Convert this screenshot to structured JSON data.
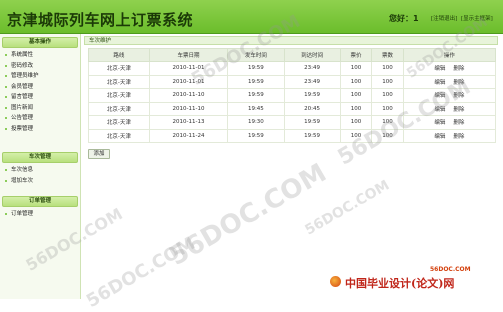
{
  "header": {
    "title": "京津城际列车网上订票系统",
    "welcome": "您好：1",
    "logout_label": "[注销退出]",
    "home_label": "[显示主框架]"
  },
  "sidebar": {
    "sections": [
      {
        "title": "基本操作",
        "items": [
          "系统属性",
          "密码修改",
          "管理员维护",
          "会员管理",
          "留言管理",
          "图片新闻",
          "公告管理",
          "投票管理"
        ]
      },
      {
        "title": "车次管理",
        "items": [
          "车次信息",
          "增加车次"
        ]
      },
      {
        "title": "订单管理",
        "items": [
          "订单管理"
        ]
      }
    ]
  },
  "main": {
    "panel_title": "车次维护",
    "columns": [
      "路线",
      "车票日期",
      "发车时间",
      "到达时间",
      "票价",
      "票数",
      "操作"
    ],
    "rows": [
      [
        "北京-天津",
        "2010-11-01",
        "19:59",
        "23:49",
        "100",
        "100"
      ],
      [
        "北京-天津",
        "2010-11-01",
        "19:59",
        "23:49",
        "100",
        "100"
      ],
      [
        "北京-天津",
        "2010-11-10",
        "19:59",
        "19:59",
        "100",
        "100"
      ],
      [
        "北京-天津",
        "2010-11-10",
        "19:45",
        "20:45",
        "100",
        "100"
      ],
      [
        "北京-天津",
        "2010-11-13",
        "19:30",
        "19:59",
        "100",
        "100"
      ],
      [
        "北京-天津",
        "2010-11-24",
        "19:59",
        "19:59",
        "100",
        "100"
      ]
    ],
    "edit_label": "编辑",
    "delete_label": "删除",
    "add_button_label": "添加"
  },
  "watermarks": [
    "56DOC.COM",
    "56DOC.COM",
    "56DOC.COM",
    "56DOC.COM",
    "56DOC.COM",
    "56DOC.COM",
    "56DOC.COM"
  ],
  "footer_logo": {
    "domain": "56DOC.COM",
    "text": "中国毕业设计(论文)网"
  },
  "colors": {
    "header_green": "#6bbd2b",
    "title_dark_green": "#1b3a07",
    "logo_red": "#c0261a"
  }
}
